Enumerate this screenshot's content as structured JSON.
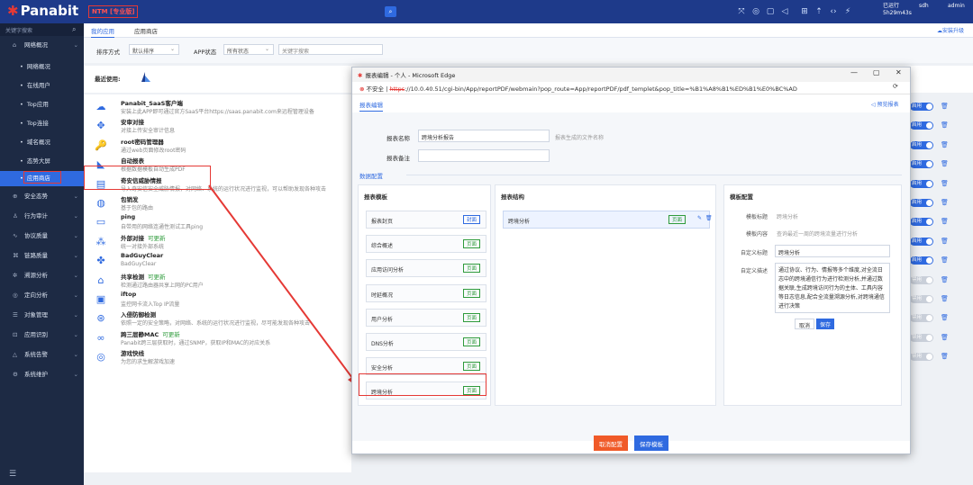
{
  "header": {
    "logo": "Panabit",
    "edition": "NTM [专业版]",
    "status_line1": "已运行",
    "status_line2": "5h29m43s",
    "user1": "sdh",
    "user2": "admin",
    "upgrade": "安装升级"
  },
  "sidebar": {
    "search_placeholder": "关键字搜索",
    "items": [
      {
        "label": "网络概况",
        "top": false
      },
      {
        "label": "网络概况"
      },
      {
        "label": "在线用户"
      },
      {
        "label": "Top应用"
      },
      {
        "label": "Top连接"
      },
      {
        "label": "域名概况"
      },
      {
        "label": "态势大屏"
      },
      {
        "label": "应用商店"
      },
      {
        "label": "安全态势"
      },
      {
        "label": "行为审计"
      },
      {
        "label": "协议质量"
      },
      {
        "label": "链路质量"
      },
      {
        "label": "溯源分析"
      },
      {
        "label": "定向分析"
      },
      {
        "label": "对象管理"
      },
      {
        "label": "应用识别"
      },
      {
        "label": "系统告警"
      },
      {
        "label": "系统维护"
      }
    ]
  },
  "tabs": {
    "my_apps": "我的应用",
    "store": "应用商店"
  },
  "filters": {
    "sort_label": "排序方式",
    "sort_value": "默认排序",
    "status_label": "APP状态",
    "status_value": "所有状态",
    "keyword_placeholder": "关键字搜索"
  },
  "recent_label": "最近使用:",
  "apps": [
    {
      "title": "Panabit_SaaS客户端",
      "desc": "安装上此APP即可通过官方SaaS平台https://saas.panabit.com来远程管理设备",
      "icon": "☁",
      "new": ""
    },
    {
      "title": "安审对接",
      "desc": "对接上传安全审计信息",
      "icon": "✥",
      "new": ""
    },
    {
      "title": "root密码管理器",
      "desc": "通过web页面修改root密码",
      "icon": "🔑",
      "new": ""
    },
    {
      "title": "自动报表",
      "desc": "根据数据模板自动生成PDF",
      "icon": "◣",
      "new": ""
    },
    {
      "title": "奇安信威胁情报",
      "desc": "导入奇安信安全威胁情报，对网络、系统的运行状况进行监视，可以帮助发现各种攻击",
      "icon": "▤",
      "new": ""
    },
    {
      "title": "包销发",
      "desc": "基于包的路由",
      "icon": "◍",
      "new": ""
    },
    {
      "title": "ping",
      "desc": "自带用的网络连通性测试工具ping",
      "icon": "▭",
      "new": ""
    },
    {
      "title": "外部对接",
      "desc": "统一对接外部系统",
      "icon": "⁂",
      "new": "可更新"
    },
    {
      "title": "BadGuyClear",
      "desc": "BadGuyClear",
      "icon": "✤",
      "new": ""
    },
    {
      "title": "共享检测",
      "desc": "检测通过路由器共享上网的PC用户",
      "icon": "⌂",
      "new": "可更新"
    },
    {
      "title": "iftop",
      "desc": "监控网卡流入Top IP流量",
      "icon": "▣",
      "new": ""
    },
    {
      "title": "入侵防御检测",
      "desc": "依照一定的安全策略，对网络、系统的运行状况进行监视，尽可能发现各种攻击",
      "icon": "⊛",
      "new": ""
    },
    {
      "title": "跨三层静MAC",
      "desc": "Panabit跨三层获取时，通过SNMP，获取IP和MAC的对应关系",
      "icon": "∞",
      "new": "可更新"
    },
    {
      "title": "游戏快线",
      "desc": "为您的求生解游戏加速",
      "icon": "◎",
      "new": ""
    }
  ],
  "toggles": [
    {
      "label": "启用",
      "on": true
    },
    {
      "label": "启用",
      "on": true
    },
    {
      "label": "启用",
      "on": true
    },
    {
      "label": "启用",
      "on": true
    },
    {
      "label": "启用",
      "on": true
    },
    {
      "label": "启用",
      "on": true
    },
    {
      "label": "启用",
      "on": true
    },
    {
      "label": "启用",
      "on": true
    },
    {
      "label": "启用",
      "on": true
    },
    {
      "label": "禁用",
      "on": false
    },
    {
      "label": "禁用",
      "on": false
    },
    {
      "label": "禁用",
      "on": false
    },
    {
      "label": "禁用",
      "on": false
    },
    {
      "label": "禁用",
      "on": false
    }
  ],
  "dialog": {
    "title": "报表编辑 - 个人 - Microsoft Edge",
    "insecure": "不安全",
    "url_https": "https",
    "url_rest": "://10.0.40.51/cgi-bin/App/reportPDF/webmain?pop_route=App/reportPDF/pdf_templet&pop_title=%B1%A8%B1%ED%B1%E0%BC%AD",
    "tab": "报表编辑",
    "preview": "预览报表",
    "name_label": "报表名称",
    "name_value": "跨境分析报告",
    "name_hint": "报表生成的文件名称",
    "remark_label": "报表备注",
    "section": "数据配置",
    "templates_title": "报表模板",
    "structure_title": "报表结构",
    "config_title": "模板配置",
    "templates": [
      {
        "label": "报表封页",
        "tag": "封面"
      },
      {
        "label": "综合概述",
        "tag": "页面"
      },
      {
        "label": "应用访问分析",
        "tag": "页面"
      },
      {
        "label": "时延概况",
        "tag": "页面"
      },
      {
        "label": "用户分析",
        "tag": "页面"
      },
      {
        "label": "DNS分析",
        "tag": "页面"
      },
      {
        "label": "安全分析",
        "tag": "页面"
      },
      {
        "label": "跨境分析",
        "tag": "页面"
      }
    ],
    "structure_item": {
      "label": "跨境分析",
      "tag": "页面"
    },
    "cfg_title_label": "模板标题",
    "cfg_title_value": "跨境分析",
    "cfg_content_label": "模板内容",
    "cfg_content_value": "查询最近一周的跨境流量进行分析",
    "custom_title_label": "自定义标题",
    "custom_title_value": "跨境分析",
    "custom_desc_label": "自定义描述",
    "custom_desc_value": "通过协议、行为、情报等多个维度,对全流日志中的跨境通信行为进行检测分析,并通过数据关联,生成跨境访问行为的主体、工具内容等日志信息,配合全流量溯源分析,对跨境通信进行决策",
    "cancel_small": "取消",
    "save_small": "保存",
    "cancel_btn": "取消配置",
    "save_btn": "保存模板"
  },
  "colors": {
    "accent": "#2f6ae0",
    "sidebar": "#1d2a44",
    "highlight": "#e53935"
  }
}
